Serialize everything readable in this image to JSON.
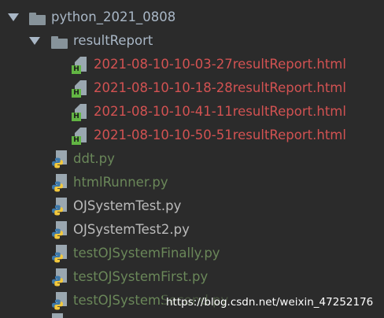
{
  "project": {
    "folder_name": "python_2021_0808",
    "subfolder_name": "resultReport",
    "reports": [
      "2021-08-10-10-03-27resultReport.html",
      "2021-08-10-10-18-28resultReport.html",
      "2021-08-10-10-41-11resultReport.html",
      "2021-08-10-10-50-51resultReport.html"
    ],
    "python_files": [
      {
        "name": "ddt.py",
        "status": "added"
      },
      {
        "name": "htmlRunner.py",
        "status": "added"
      },
      {
        "name": "OJSystemTest.py",
        "status": "unchanged"
      },
      {
        "name": "OJSystemTest2.py",
        "status": "unchanged"
      },
      {
        "name": "testOJSystemFinally.py",
        "status": "added"
      },
      {
        "name": "testOJSystemFirst.py",
        "status": "added"
      },
      {
        "name": "testOJSystemSecond.py",
        "status": "added"
      }
    ]
  },
  "colors": {
    "background": "#2b2b2b",
    "default_text": "#a9b7c6",
    "untracked_red": "#d25252",
    "added_green": "#6a8759",
    "html_badge": "#62b543"
  },
  "watermark": "https://blog.csdn.net/weixin_47252176"
}
